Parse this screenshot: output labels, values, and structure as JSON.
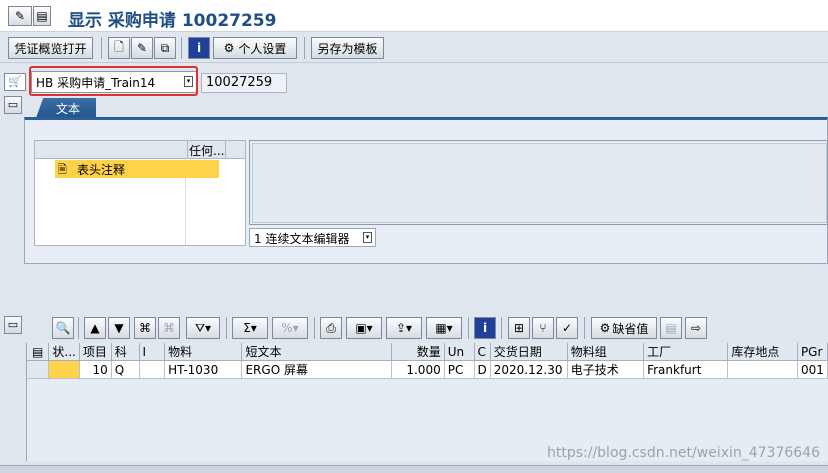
{
  "title": "显示 采购申请 10027259",
  "toolbar": {
    "voucher_overview": "凭证概览打开",
    "personal_settings": "个人设置",
    "save_as_template": "另存为模板"
  },
  "header": {
    "doc_type": "HB 采购申请_Train14",
    "doc_number": "10027259"
  },
  "tabs": {
    "text_tab": "文本"
  },
  "tree": {
    "col2_header": "任何...",
    "item_label": "表头注释"
  },
  "editor": {
    "mode_label": "1 连续文本编辑器"
  },
  "items": {
    "defaults_label": "缺省值",
    "columns": [
      "状...",
      "项目",
      "科",
      "I",
      "物料",
      "短文本",
      "数量",
      "Un",
      "C",
      "交货日期",
      "物料组",
      "工厂",
      "库存地点",
      "PGr"
    ],
    "rows": [
      [
        "",
        "10",
        "Q",
        "",
        "HT-1030",
        "ERGO 屏幕",
        "1.000",
        "PC",
        "D",
        "2020.12.30",
        "电子技术",
        "Frankfurt",
        "",
        "001"
      ]
    ]
  },
  "watermark": "https://blog.csdn.net/weixin_47376646",
  "colors": {
    "title": "#1f4f84",
    "selection": "#ffd24a",
    "highlight_box": "#e0302f",
    "tab": "#21558c"
  }
}
